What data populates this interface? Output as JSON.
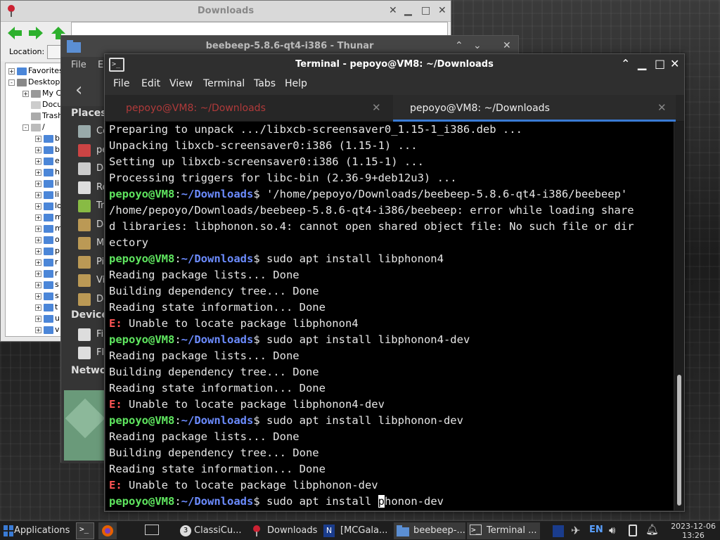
{
  "downloads_window": {
    "title": "Downloads",
    "location_label": "Location:",
    "tree": [
      {
        "label": "Favorites",
        "box": "+"
      },
      {
        "label": "Desktop",
        "box": "-"
      },
      {
        "label": "My Co",
        "box": "+"
      },
      {
        "label": "Docu",
        "box": ""
      },
      {
        "label": "Trash",
        "box": ""
      },
      {
        "label": "/",
        "box": "-"
      }
    ],
    "tree_sub_letters": [
      "b",
      "b",
      "e",
      "h",
      "li",
      "li",
      "lo",
      "m",
      "m",
      "o",
      "p",
      "r",
      "r",
      "s",
      "s",
      "t",
      "u",
      "v"
    ]
  },
  "thunar_window": {
    "title": "beebeep-5.8.6-qt4-i386 - Thunar",
    "menu_file": "File",
    "menu_edit": "E",
    "places_header": "Places",
    "devices_header": "Device",
    "network_header": "Netwo",
    "places": [
      "Co",
      "pe",
      "De",
      "Re",
      "Tr",
      "Do",
      "M",
      "Pi",
      "Vi",
      "Do"
    ],
    "devices": [
      "Fi",
      "Fl"
    ]
  },
  "terminal_window": {
    "title": "Terminal - pepoyo@VM8: ~/Downloads",
    "menu": [
      "File",
      "Edit",
      "View",
      "Terminal",
      "Tabs",
      "Help"
    ],
    "tabs": [
      {
        "label": "pepoyo@VM8: ~/Downloads",
        "active": false
      },
      {
        "label": "pepoyo@VM8: ~/Downloads",
        "active": true
      }
    ],
    "prompt_user": "pepoyo@VM8",
    "prompt_colon": ":",
    "prompt_path": "~/Downloads",
    "prompt_dollar": "$",
    "error_prefix": "E:",
    "lines": [
      {
        "type": "out",
        "text": "Preparing to unpack .../libxcb-screensaver0_1.15-1_i386.deb ..."
      },
      {
        "type": "out",
        "text": "Unpacking libxcb-screensaver0:i386 (1.15-1) ..."
      },
      {
        "type": "out",
        "text": "Setting up libxcb-screensaver0:i386 (1.15-1) ..."
      },
      {
        "type": "out",
        "text": "Processing triggers for libc-bin (2.36-9+deb12u3) ..."
      },
      {
        "type": "cmd",
        "text": " '/home/pepoyo/Downloads/beebeep-5.8.6-qt4-i386/beebeep'"
      },
      {
        "type": "out",
        "text": "/home/pepoyo/Downloads/beebeep-5.8.6-qt4-i386/beebeep: error while loading share"
      },
      {
        "type": "out",
        "text": "d libraries: libphonon.so.4: cannot open shared object file: No such file or dir"
      },
      {
        "type": "out",
        "text": "ectory"
      },
      {
        "type": "cmd",
        "text": " sudo apt install libphonon4"
      },
      {
        "type": "out",
        "text": "Reading package lists... Done"
      },
      {
        "type": "out",
        "text": "Building dependency tree... Done"
      },
      {
        "type": "out",
        "text": "Reading state information... Done"
      },
      {
        "type": "err",
        "text": " Unable to locate package libphonon4"
      },
      {
        "type": "cmd",
        "text": " sudo apt install libphonon4-dev"
      },
      {
        "type": "out",
        "text": "Reading package lists... Done"
      },
      {
        "type": "out",
        "text": "Building dependency tree... Done"
      },
      {
        "type": "out",
        "text": "Reading state information... Done"
      },
      {
        "type": "err",
        "text": " Unable to locate package libphonon4-dev"
      },
      {
        "type": "cmd",
        "text": " sudo apt install libphonon-dev"
      },
      {
        "type": "out",
        "text": "Reading package lists... Done"
      },
      {
        "type": "out",
        "text": "Building dependency tree... Done"
      },
      {
        "type": "out",
        "text": "Reading state information... Done"
      },
      {
        "type": "err",
        "text": " Unable to locate package libphonon-dev"
      },
      {
        "type": "cmd_cursor",
        "before": " sudo apt install ",
        "cursor": "p",
        "after": "honon-dev"
      }
    ]
  },
  "taskbar": {
    "applications_label": "Applications",
    "items": [
      {
        "label": "ClassiCu...",
        "badge": "3",
        "icon": "app-group-icon"
      },
      {
        "label": "Downloads",
        "icon": "downloads-icon"
      },
      {
        "label": "[MCGala...",
        "icon": "editor-icon"
      },
      {
        "label": "beebeep-...",
        "icon": "folder-icon"
      },
      {
        "label": "Terminal ...",
        "icon": "terminal-icon"
      }
    ],
    "keyboard_layout": "EN",
    "date": "2023-12-06",
    "time": "13:26"
  },
  "colors": {
    "prompt_user": "#5fe55f",
    "prompt_path": "#6c8cff",
    "error": "#ff5555",
    "accent": "#3a7bd5"
  }
}
